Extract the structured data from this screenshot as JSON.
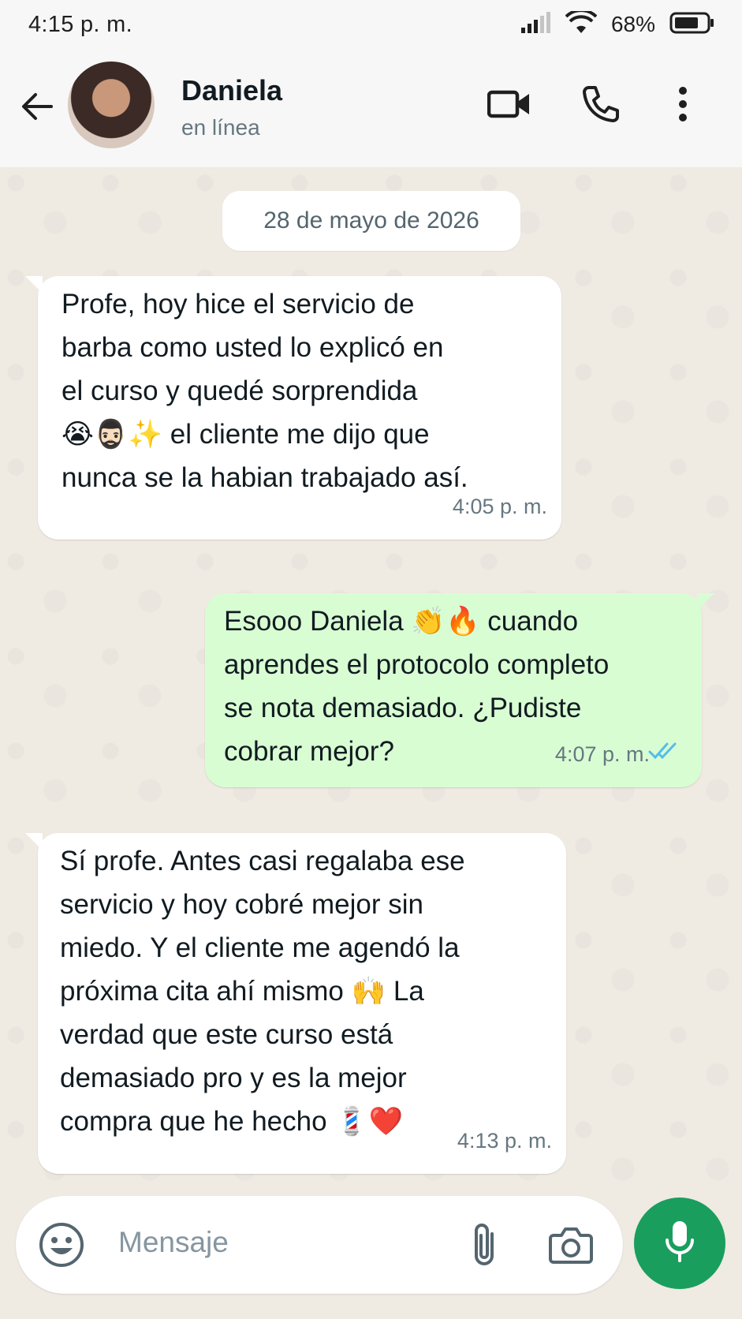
{
  "status_bar": {
    "time": "4:15 p. m.",
    "battery": "68%"
  },
  "header": {
    "contact_name": "Daniela",
    "contact_status": "en línea"
  },
  "chat": {
    "date": "28 de mayo de 2026",
    "messages": [
      {
        "direction": "incoming",
        "text": "Profe, hoy hice el servicio de\nbarba como usted lo explicó en\nel curso y quedé sorprendida\n😭🧔🏻‍♂️✨ el cliente me dijo que\nnunca se la habian trabajado así.",
        "time": "4:05 p. m."
      },
      {
        "direction": "outgoing",
        "text": "Esooo Daniela 👏🔥 cuando\naprendes el protocolo completo\nse nota demasiado. ¿Pudiste\ncobrar mejor?",
        "time": "4:07 p. m.",
        "status": "read"
      },
      {
        "direction": "incoming",
        "text": "Sí profe. Antes casi regalaba ese\nservicio y hoy cobré mejor sin\nmiedo. Y el cliente me agendó la\npróxima cita ahí mismo 🙌 La\nverdad que este curso está\ndemasiado pro y es la mejor\ncompra que he hecho 💈❤️",
        "time": "4:13 p. m."
      }
    ]
  },
  "composer": {
    "placeholder": "Mensaje"
  },
  "colors": {
    "incoming_bubble": "#ffffff",
    "outgoing_bubble": "#d9fdd3",
    "mic_button": "#1a9e5e",
    "read_ticks": "#53bdeb"
  },
  "icons": [
    "back-arrow-icon",
    "video-call-icon",
    "phone-icon",
    "more-vertical-icon",
    "emoji-icon",
    "attach-icon",
    "camera-icon",
    "mic-icon",
    "signal-icon",
    "wifi-icon",
    "battery-icon",
    "double-check-icon"
  ]
}
